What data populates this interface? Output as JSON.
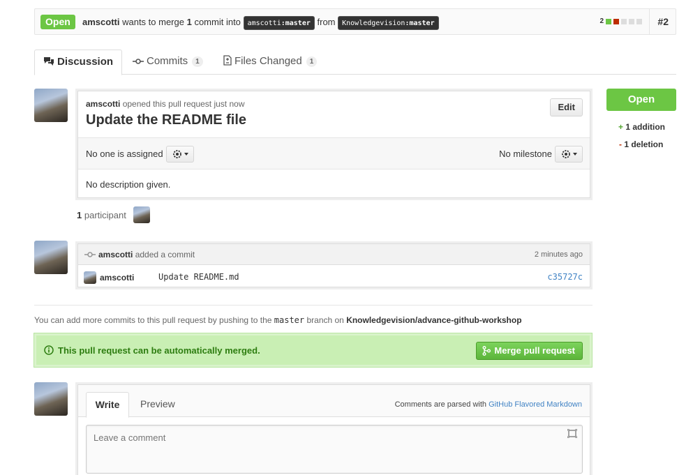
{
  "pr": {
    "state": "Open",
    "author": "amscotti",
    "wants_to_merge": "wants to merge",
    "commit_count": "1",
    "commit_word": "commit into",
    "base_user": "amscotti",
    "base_branch": "master",
    "from_word": "from",
    "head_user": "Knowledgevision",
    "head_branch": "master",
    "diffstat_count": "2",
    "number": "#2"
  },
  "tabs": [
    {
      "label": "Discussion",
      "count": ""
    },
    {
      "label": "Commits",
      "count": "1"
    },
    {
      "label": "Files Changed",
      "count": "1"
    }
  ],
  "opening": {
    "author": "amscotti",
    "action": "opened this pull request just now",
    "title": "Update the README file",
    "edit_label": "Edit",
    "assignee_text": "No one is assigned",
    "milestone_text": "No milestone",
    "description": "No description given."
  },
  "participants": {
    "count": "1",
    "label": "participant"
  },
  "commit_event": {
    "author": "amscotti",
    "action": "added a commit",
    "time": "2 minutes ago",
    "commit_author": "amscotti",
    "message": "Update README.md",
    "sha": "c35727c"
  },
  "push_hint": {
    "prefix": "You can add more commits to this pull request by pushing to the",
    "branch": "master",
    "middle": "branch on",
    "repo": "Knowledgevision/advance-github-workshop"
  },
  "merge": {
    "message": "This pull request can be automatically merged.",
    "button": "Merge pull request"
  },
  "comment": {
    "tab_write": "Write",
    "tab_preview": "Preview",
    "parsed_prefix": "Comments are parsed with",
    "parsed_link": "GitHub Flavored Markdown",
    "placeholder": "Leave a comment"
  },
  "sidebar": {
    "state_button": "Open",
    "additions": "+ 1 addition",
    "deletions": "- 1 deletion"
  },
  "colors": {
    "open_green": "#6cc644",
    "addition": "#55a532",
    "deletion": "#bd2c00",
    "link": "#4183c4"
  }
}
